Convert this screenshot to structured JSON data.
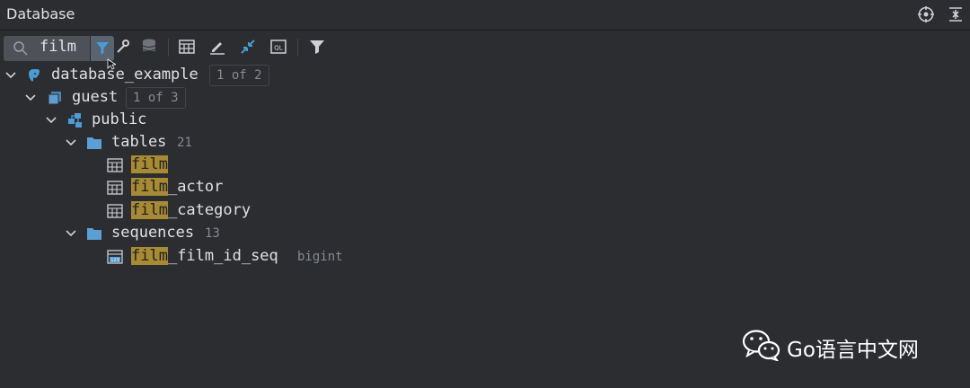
{
  "panel": {
    "title": "Database"
  },
  "search": {
    "value": "film"
  },
  "icons": {
    "title_actions": [
      "crosshair-icon",
      "collapse-icon"
    ],
    "toolbar": [
      "filter-icon",
      "settings-icon",
      "database-stack-icon",
      "table-grid-icon",
      "edit-icon",
      "jump-icon",
      "query-console-icon",
      "filter-icon"
    ]
  },
  "tree": {
    "root": {
      "label": "database_example",
      "badge": "1 of 2"
    },
    "schema": {
      "label": "guest",
      "badge": "1 of 3"
    },
    "public": {
      "label": "public"
    },
    "tables": {
      "label": "tables",
      "count": "21",
      "items": [
        {
          "match": "film",
          "rest": ""
        },
        {
          "match": "film",
          "rest": "_actor"
        },
        {
          "match": "film",
          "rest": "_category"
        }
      ]
    },
    "sequences": {
      "label": "sequences",
      "count": "13",
      "items": [
        {
          "match": "film",
          "rest": "_film_id_seq",
          "type": "bigint"
        }
      ]
    }
  },
  "watermark": {
    "text": "Go语言中文网"
  },
  "colors": {
    "background": "#2b2d30",
    "highlight": "#a88a32",
    "accent_blue": "#4a9cd6"
  }
}
